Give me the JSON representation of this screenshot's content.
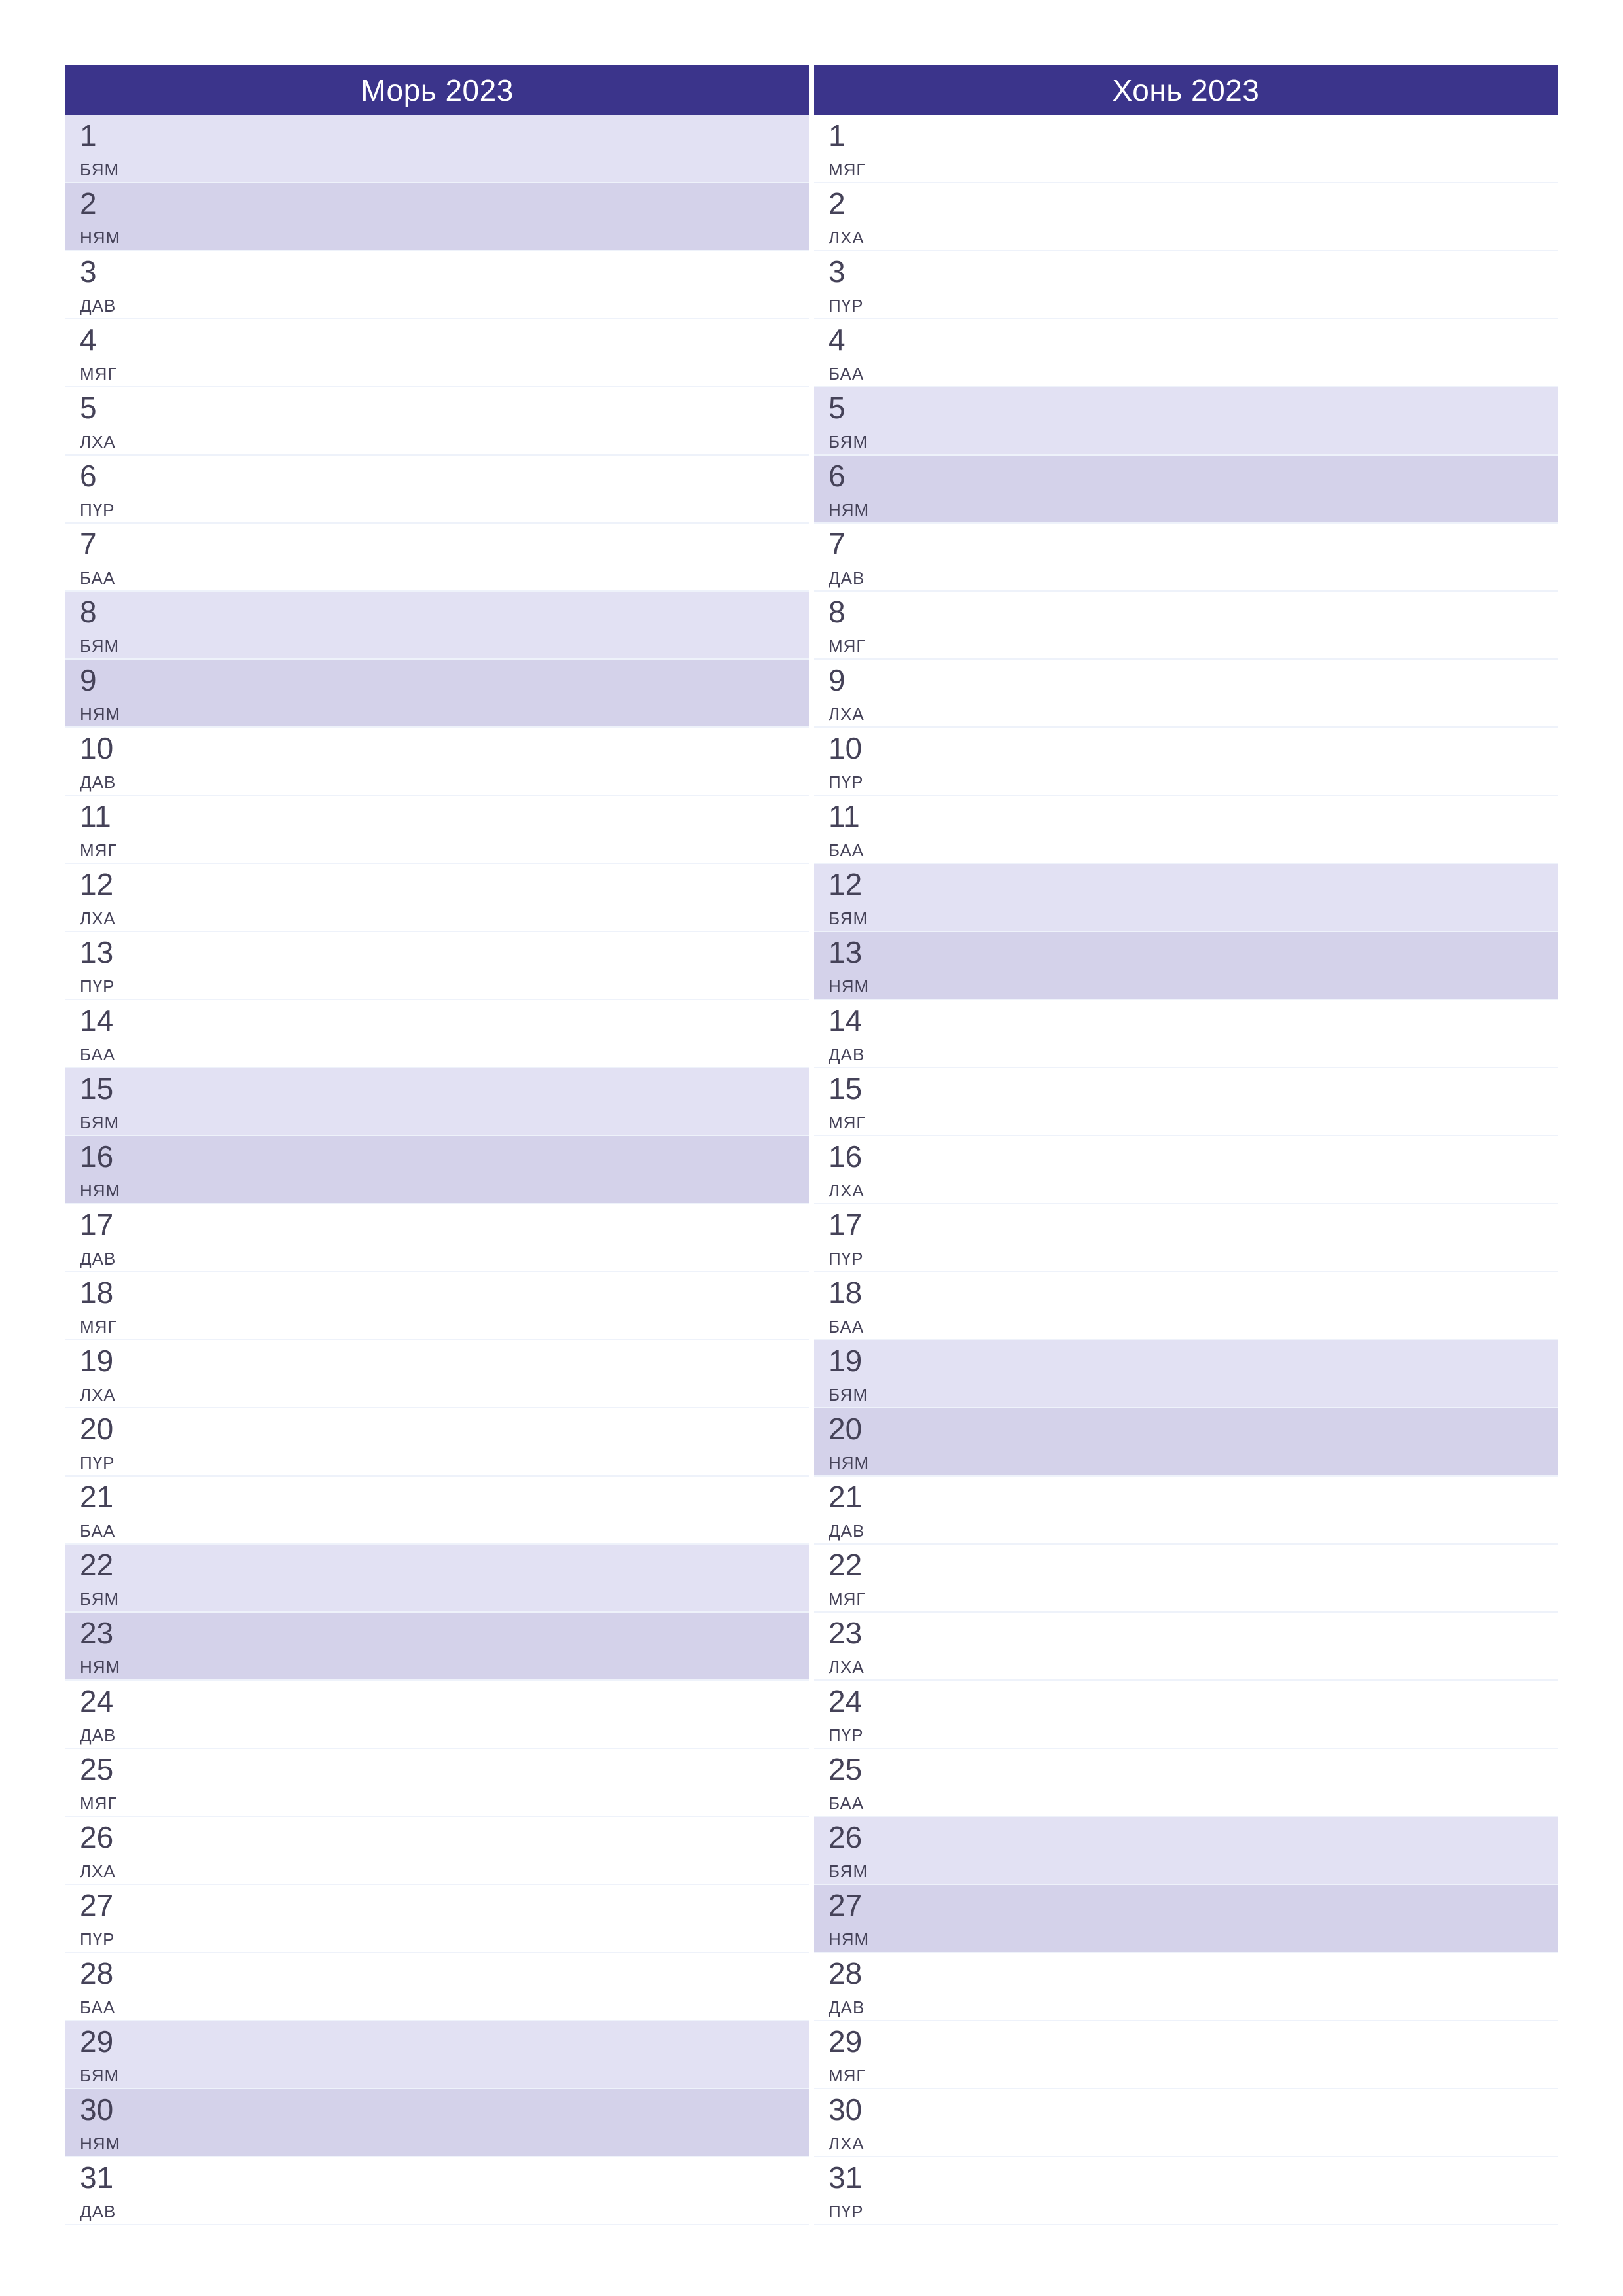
{
  "months": [
    {
      "title": "Морь 2023",
      "days": [
        {
          "n": "1",
          "dow": "БЯМ",
          "shade": "light"
        },
        {
          "n": "2",
          "dow": "НЯМ",
          "shade": "mid"
        },
        {
          "n": "3",
          "dow": "ДАВ",
          "shade": "none"
        },
        {
          "n": "4",
          "dow": "МЯГ",
          "shade": "none"
        },
        {
          "n": "5",
          "dow": "ЛХА",
          "shade": "none"
        },
        {
          "n": "6",
          "dow": "ПҮР",
          "shade": "none"
        },
        {
          "n": "7",
          "dow": "БАА",
          "shade": "none"
        },
        {
          "n": "8",
          "dow": "БЯМ",
          "shade": "light"
        },
        {
          "n": "9",
          "dow": "НЯМ",
          "shade": "mid"
        },
        {
          "n": "10",
          "dow": "ДАВ",
          "shade": "none"
        },
        {
          "n": "11",
          "dow": "МЯГ",
          "shade": "none"
        },
        {
          "n": "12",
          "dow": "ЛХА",
          "shade": "none"
        },
        {
          "n": "13",
          "dow": "ПҮР",
          "shade": "none"
        },
        {
          "n": "14",
          "dow": "БАА",
          "shade": "none"
        },
        {
          "n": "15",
          "dow": "БЯМ",
          "shade": "light"
        },
        {
          "n": "16",
          "dow": "НЯМ",
          "shade": "mid"
        },
        {
          "n": "17",
          "dow": "ДАВ",
          "shade": "none"
        },
        {
          "n": "18",
          "dow": "МЯГ",
          "shade": "none"
        },
        {
          "n": "19",
          "dow": "ЛХА",
          "shade": "none"
        },
        {
          "n": "20",
          "dow": "ПҮР",
          "shade": "none"
        },
        {
          "n": "21",
          "dow": "БАА",
          "shade": "none"
        },
        {
          "n": "22",
          "dow": "БЯМ",
          "shade": "light"
        },
        {
          "n": "23",
          "dow": "НЯМ",
          "shade": "mid"
        },
        {
          "n": "24",
          "dow": "ДАВ",
          "shade": "none"
        },
        {
          "n": "25",
          "dow": "МЯГ",
          "shade": "none"
        },
        {
          "n": "26",
          "dow": "ЛХА",
          "shade": "none"
        },
        {
          "n": "27",
          "dow": "ПҮР",
          "shade": "none"
        },
        {
          "n": "28",
          "dow": "БАА",
          "shade": "none"
        },
        {
          "n": "29",
          "dow": "БЯМ",
          "shade": "light"
        },
        {
          "n": "30",
          "dow": "НЯМ",
          "shade": "mid"
        },
        {
          "n": "31",
          "dow": "ДАВ",
          "shade": "none"
        }
      ]
    },
    {
      "title": "Хонь 2023",
      "days": [
        {
          "n": "1",
          "dow": "МЯГ",
          "shade": "none"
        },
        {
          "n": "2",
          "dow": "ЛХА",
          "shade": "none"
        },
        {
          "n": "3",
          "dow": "ПҮР",
          "shade": "none"
        },
        {
          "n": "4",
          "dow": "БАА",
          "shade": "none"
        },
        {
          "n": "5",
          "dow": "БЯМ",
          "shade": "light"
        },
        {
          "n": "6",
          "dow": "НЯМ",
          "shade": "mid"
        },
        {
          "n": "7",
          "dow": "ДАВ",
          "shade": "none"
        },
        {
          "n": "8",
          "dow": "МЯГ",
          "shade": "none"
        },
        {
          "n": "9",
          "dow": "ЛХА",
          "shade": "none"
        },
        {
          "n": "10",
          "dow": "ПҮР",
          "shade": "none"
        },
        {
          "n": "11",
          "dow": "БАА",
          "shade": "none"
        },
        {
          "n": "12",
          "dow": "БЯМ",
          "shade": "light"
        },
        {
          "n": "13",
          "dow": "НЯМ",
          "shade": "mid"
        },
        {
          "n": "14",
          "dow": "ДАВ",
          "shade": "none"
        },
        {
          "n": "15",
          "dow": "МЯГ",
          "shade": "none"
        },
        {
          "n": "16",
          "dow": "ЛХА",
          "shade": "none"
        },
        {
          "n": "17",
          "dow": "ПҮР",
          "shade": "none"
        },
        {
          "n": "18",
          "dow": "БАА",
          "shade": "none"
        },
        {
          "n": "19",
          "dow": "БЯМ",
          "shade": "light"
        },
        {
          "n": "20",
          "dow": "НЯМ",
          "shade": "mid"
        },
        {
          "n": "21",
          "dow": "ДАВ",
          "shade": "none"
        },
        {
          "n": "22",
          "dow": "МЯГ",
          "shade": "none"
        },
        {
          "n": "23",
          "dow": "ЛХА",
          "shade": "none"
        },
        {
          "n": "24",
          "dow": "ПҮР",
          "shade": "none"
        },
        {
          "n": "25",
          "dow": "БАА",
          "shade": "none"
        },
        {
          "n": "26",
          "dow": "БЯМ",
          "shade": "light"
        },
        {
          "n": "27",
          "dow": "НЯМ",
          "shade": "mid"
        },
        {
          "n": "28",
          "dow": "ДАВ",
          "shade": "none"
        },
        {
          "n": "29",
          "dow": "МЯГ",
          "shade": "none"
        },
        {
          "n": "30",
          "dow": "ЛХА",
          "shade": "none"
        },
        {
          "n": "31",
          "dow": "ПҮР",
          "shade": "none"
        }
      ]
    }
  ]
}
